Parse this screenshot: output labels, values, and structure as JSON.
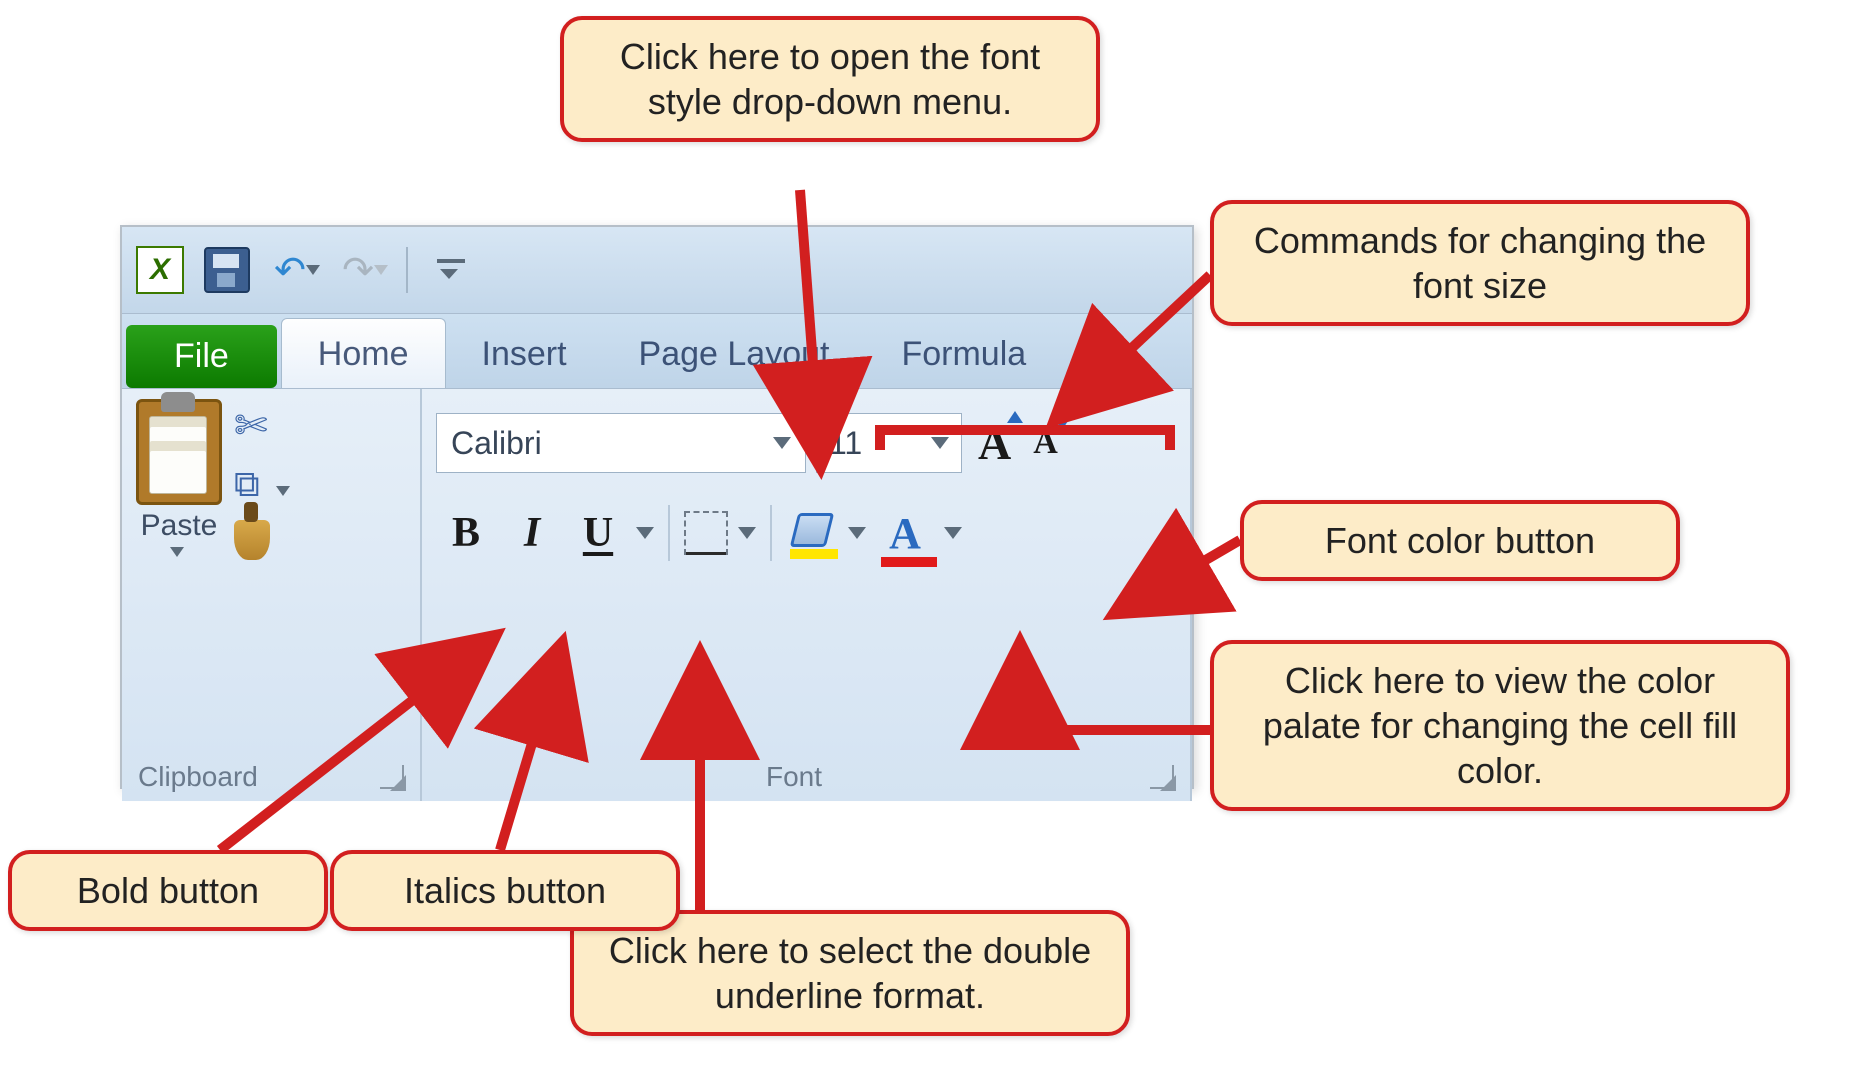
{
  "qat": {
    "app": "X"
  },
  "tabs": {
    "file": "File",
    "home": "Home",
    "insert": "Insert",
    "pagelayout": "Page Layout",
    "formulas": "Formula"
  },
  "clipboard": {
    "paste": "Paste",
    "group_label": "Clipboard"
  },
  "font": {
    "name": "Calibri",
    "size": "11",
    "group_label": "Font"
  },
  "callouts": {
    "font_style_dd": "Click here to open the font style drop-down menu.",
    "font_size_cmds": "Commands for changing the font size",
    "font_color_btn": "Font color button",
    "fill_color_dd": "Click here to view the color palate for changing the cell fill color.",
    "double_underline": "Click here to select the double underline format.",
    "bold": "Bold button",
    "italics": "Italics button"
  }
}
